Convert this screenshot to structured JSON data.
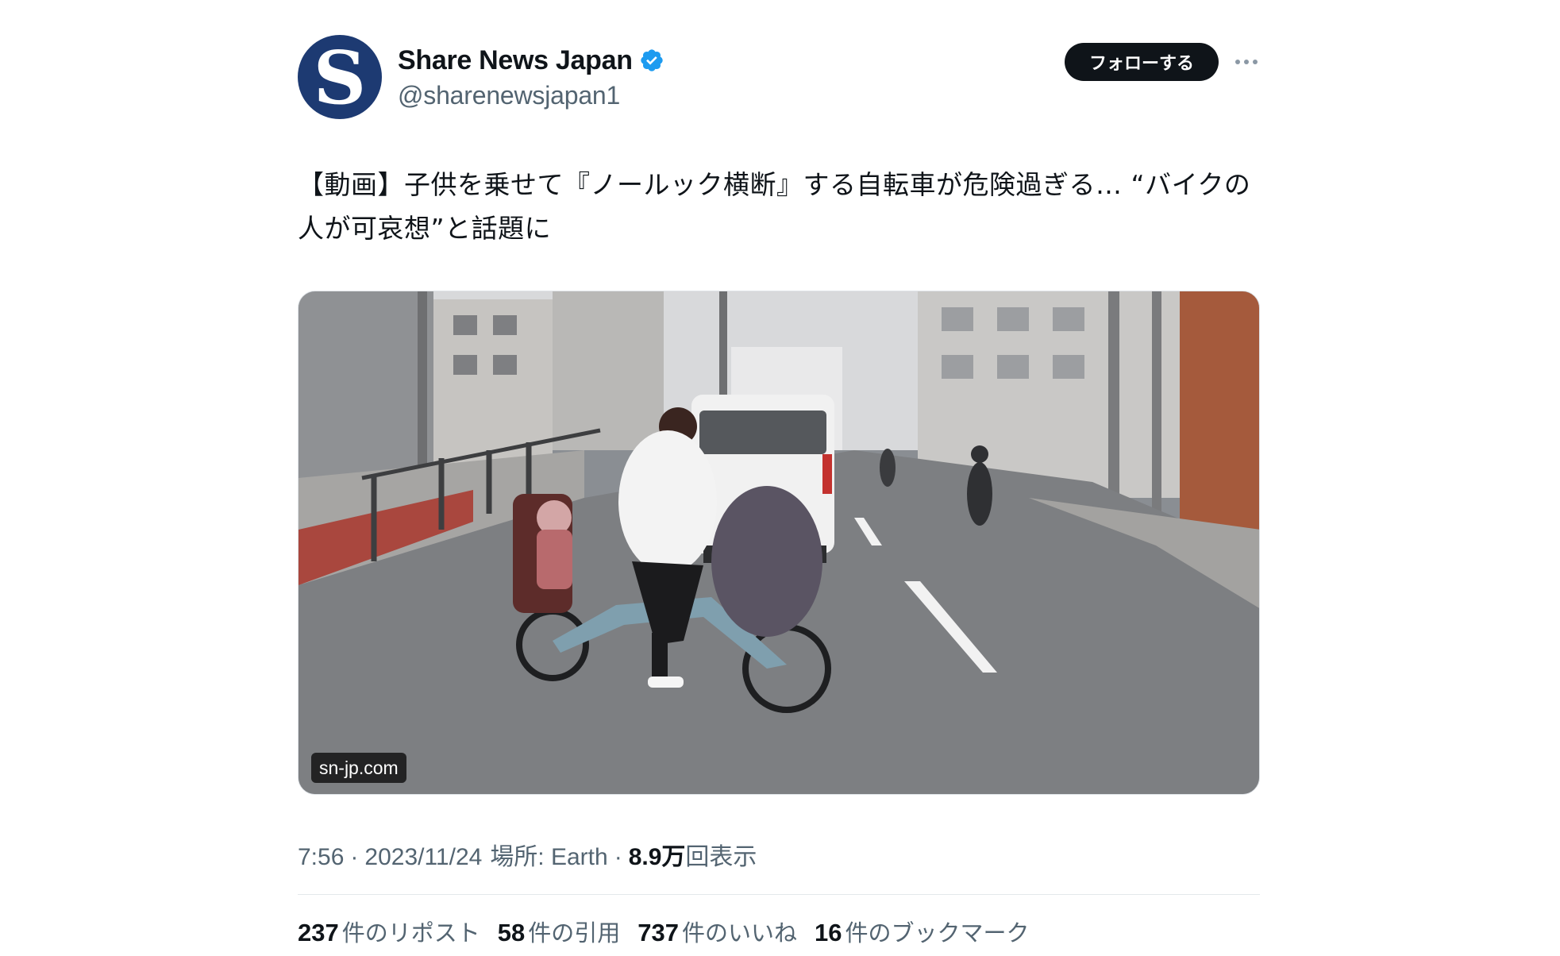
{
  "author": {
    "display_name": "Share News Japan",
    "handle": "@sharenewsjapan1",
    "avatar_letter": "S",
    "avatar_color": "#1d3a72",
    "verified_icon": "verified-badge-icon",
    "verified_color": "#1d9bf0"
  },
  "actions": {
    "follow_label": "フォローする",
    "more_icon": "more-options-icon"
  },
  "tweet": {
    "text": "【動画】子供を乗せて『ノールック横断』する自転車が危険過ぎる… “バイクの人が可哀想”と話題に",
    "media_source_label": "sn-jp.com"
  },
  "meta": {
    "time": "7:56",
    "separator": "·",
    "date": "2023/11/24",
    "location_label": "場所: Earth",
    "views_count": "8.9万",
    "views_label": "回表示"
  },
  "stats": [
    {
      "count": "237",
      "label": "件のリポスト"
    },
    {
      "count": "58",
      "label": "件の引用"
    },
    {
      "count": "737",
      "label": "件のいいね"
    },
    {
      "count": "16",
      "label": "件のブックマーク"
    }
  ]
}
